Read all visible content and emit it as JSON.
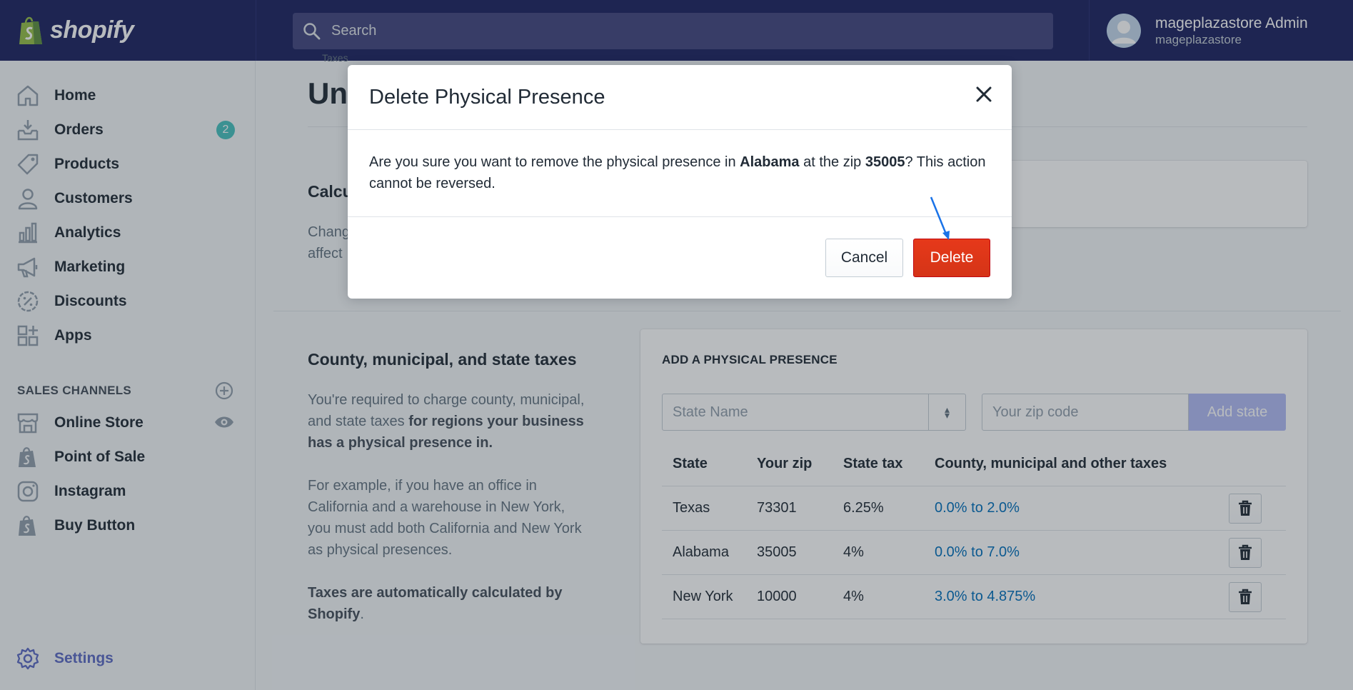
{
  "topbar": {
    "brand": "shopify",
    "search_placeholder": "Search",
    "account_name": "mageplazastore Admin",
    "account_store": "mageplazastore"
  },
  "sidebar": {
    "items": [
      {
        "label": "Home",
        "icon": "home-icon"
      },
      {
        "label": "Orders",
        "icon": "orders-icon",
        "badge": "2"
      },
      {
        "label": "Products",
        "icon": "tag-icon"
      },
      {
        "label": "Customers",
        "icon": "person-icon"
      },
      {
        "label": "Analytics",
        "icon": "bar-chart-icon"
      },
      {
        "label": "Marketing",
        "icon": "megaphone-icon"
      },
      {
        "label": "Discounts",
        "icon": "discount-icon"
      },
      {
        "label": "Apps",
        "icon": "apps-icon"
      }
    ],
    "channels_heading": "SALES CHANNELS",
    "channels": [
      {
        "label": "Online Store",
        "icon": "store-icon"
      },
      {
        "label": "Point of Sale",
        "icon": "pos-icon"
      },
      {
        "label": "Instagram",
        "icon": "instagram-icon"
      },
      {
        "label": "Buy Button",
        "icon": "buy-button-icon"
      }
    ],
    "settings": "Settings"
  },
  "main": {
    "breadcrumb": "Taxes",
    "page_title": "Un",
    "calc_title": "Calcu",
    "calc_text_1": "Chang",
    "calc_text_2": "affect",
    "section_title": "County, municipal, and state taxes",
    "desc_p1_a": "You're required to charge county, municipal, and state taxes ",
    "desc_p1_b": "for regions your business has a physical presence in.",
    "desc_p2": "For example, if you have an office in California and a warehouse in New York, you must add both California and New York as physical presences.",
    "desc_p3_a": "Taxes are automatically calculated by Shopify",
    "desc_p3_b": ".",
    "card": {
      "heading": "ADD A PHYSICAL PRESENCE",
      "state_placeholder": "State Name",
      "zip_placeholder": "Your zip code",
      "add_button": "Add state",
      "columns": [
        "State",
        "Your zip",
        "State tax",
        "County, municipal and other taxes"
      ],
      "rows": [
        {
          "state": "Texas",
          "zip": "73301",
          "tax": "6.25%",
          "other": "0.0% to 2.0%"
        },
        {
          "state": "Alabama",
          "zip": "35005",
          "tax": "4%",
          "other": "0.0% to 7.0%"
        },
        {
          "state": "New York",
          "zip": "10000",
          "tax": "4%",
          "other": "3.0% to 4.875%"
        }
      ]
    }
  },
  "modal": {
    "title": "Delete Physical Presence",
    "body_1": "Are you sure you want to remove the physical presence in ",
    "body_state": "Alabama",
    "body_2": " at the zip ",
    "body_zip": "35005",
    "body_3": "? This action cannot be reversed.",
    "cancel": "Cancel",
    "delete": "Delete"
  },
  "colors": {
    "topbar": "#1c2260",
    "accent": "#5c6ac4",
    "danger": "#de3618",
    "link": "#006fbb"
  }
}
